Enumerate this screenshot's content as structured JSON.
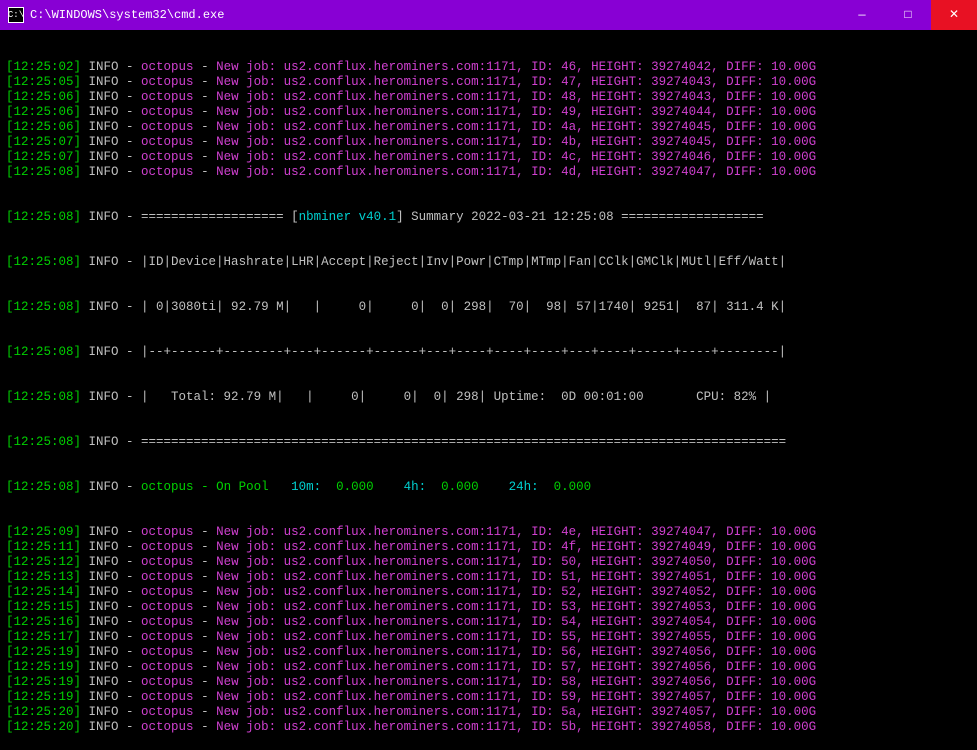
{
  "window": {
    "icon_symbol": "C:\\",
    "title": "C:\\WINDOWS\\system32\\cmd.exe",
    "minimize": "—",
    "maximize": "□",
    "close": "✕"
  },
  "lines": [
    {
      "ts": "[12:25:02]",
      "lvl": "INFO - ",
      "algo": "octopus",
      "sep": " - ",
      "rest": "New job: us2.conflux.herominers.com:1171, ID: 46, HEIGHT: 39274042, DIFF: 10.00G"
    },
    {
      "ts": "[12:25:05]",
      "lvl": "INFO - ",
      "algo": "octopus",
      "sep": " - ",
      "rest": "New job: us2.conflux.herominers.com:1171, ID: 47, HEIGHT: 39274043, DIFF: 10.00G"
    },
    {
      "ts": "[12:25:06]",
      "lvl": "INFO - ",
      "algo": "octopus",
      "sep": " - ",
      "rest": "New job: us2.conflux.herominers.com:1171, ID: 48, HEIGHT: 39274043, DIFF: 10.00G"
    },
    {
      "ts": "[12:25:06]",
      "lvl": "INFO - ",
      "algo": "octopus",
      "sep": " - ",
      "rest": "New job: us2.conflux.herominers.com:1171, ID: 49, HEIGHT: 39274044, DIFF: 10.00G"
    },
    {
      "ts": "[12:25:06]",
      "lvl": "INFO - ",
      "algo": "octopus",
      "sep": " - ",
      "rest": "New job: us2.conflux.herominers.com:1171, ID: 4a, HEIGHT: 39274045, DIFF: 10.00G"
    },
    {
      "ts": "[12:25:07]",
      "lvl": "INFO - ",
      "algo": "octopus",
      "sep": " - ",
      "rest": "New job: us2.conflux.herominers.com:1171, ID: 4b, HEIGHT: 39274045, DIFF: 10.00G"
    },
    {
      "ts": "[12:25:07]",
      "lvl": "INFO - ",
      "algo": "octopus",
      "sep": " - ",
      "rest": "New job: us2.conflux.herominers.com:1171, ID: 4c, HEIGHT: 39274046, DIFF: 10.00G"
    },
    {
      "ts": "[12:25:08]",
      "lvl": "INFO - ",
      "algo": "octopus",
      "sep": " - ",
      "rest": "New job: us2.conflux.herominers.com:1171, ID: 4d, HEIGHT: 39274047, DIFF: 10.00G"
    }
  ],
  "summary": {
    "row1": {
      "ts": "[12:25:08]",
      "lvl": "INFO - ",
      "txt": "=================== [",
      "prog": "nbminer v40.1",
      "mid": "] Summary 2022-03-21 12:25:08 ==================="
    },
    "row2": {
      "ts": "[12:25:08]",
      "lvl": "INFO - ",
      "txt": "|ID|Device|Hashrate|LHR|Accept|Reject|Inv|Powr|CTmp|MTmp|Fan|CClk|GMClk|MUtl|Eff/Watt|"
    },
    "row3": {
      "ts": "[12:25:08]",
      "lvl": "INFO - ",
      "txt": "| 0|3080ti| 92.79 M|   |     0|     0|  0| 298|  70|  98| 57|1740| 9251|  87| 311.4 K|"
    },
    "row4": {
      "ts": "[12:25:08]",
      "lvl": "INFO - ",
      "txt": "|--+------+--------+---+------+------+---+----+----+----+---+----+-----+----+--------|"
    },
    "row5": {
      "ts": "[12:25:08]",
      "lvl": "INFO - ",
      "txt": "|   Total: 92.79 M|   |     0|     0|  0| 298| Uptime:  0D 00:01:00       CPU: 82% |"
    },
    "row6": {
      "ts": "[12:25:08]",
      "lvl": "INFO - ",
      "txt": "======================================================================================"
    }
  },
  "poolrow": {
    "ts": "[12:25:08]",
    "lvl": "INFO - ",
    "algo": "octopus",
    "sep": " - On Pool   ",
    "p1": "10m:  ",
    "v1": "0.000",
    "p2": "    4h:  ",
    "v2": "0.000",
    "p3": "    24h:  ",
    "v3": "0.000"
  },
  "lines2": [
    {
      "ts": "[12:25:09]",
      "lvl": "INFO - ",
      "algo": "octopus",
      "sep": " - ",
      "rest": "New job: us2.conflux.herominers.com:1171, ID: 4e, HEIGHT: 39274047, DIFF: 10.00G"
    },
    {
      "ts": "[12:25:11]",
      "lvl": "INFO - ",
      "algo": "octopus",
      "sep": " - ",
      "rest": "New job: us2.conflux.herominers.com:1171, ID: 4f, HEIGHT: 39274049, DIFF: 10.00G"
    },
    {
      "ts": "[12:25:12]",
      "lvl": "INFO - ",
      "algo": "octopus",
      "sep": " - ",
      "rest": "New job: us2.conflux.herominers.com:1171, ID: 50, HEIGHT: 39274050, DIFF: 10.00G"
    },
    {
      "ts": "[12:25:13]",
      "lvl": "INFO - ",
      "algo": "octopus",
      "sep": " - ",
      "rest": "New job: us2.conflux.herominers.com:1171, ID: 51, HEIGHT: 39274051, DIFF: 10.00G"
    },
    {
      "ts": "[12:25:14]",
      "lvl": "INFO - ",
      "algo": "octopus",
      "sep": " - ",
      "rest": "New job: us2.conflux.herominers.com:1171, ID: 52, HEIGHT: 39274052, DIFF: 10.00G"
    },
    {
      "ts": "[12:25:15]",
      "lvl": "INFO - ",
      "algo": "octopus",
      "sep": " - ",
      "rest": "New job: us2.conflux.herominers.com:1171, ID: 53, HEIGHT: 39274053, DIFF: 10.00G"
    },
    {
      "ts": "[12:25:16]",
      "lvl": "INFO - ",
      "algo": "octopus",
      "sep": " - ",
      "rest": "New job: us2.conflux.herominers.com:1171, ID: 54, HEIGHT: 39274054, DIFF: 10.00G"
    },
    {
      "ts": "[12:25:17]",
      "lvl": "INFO - ",
      "algo": "octopus",
      "sep": " - ",
      "rest": "New job: us2.conflux.herominers.com:1171, ID: 55, HEIGHT: 39274055, DIFF: 10.00G"
    },
    {
      "ts": "[12:25:19]",
      "lvl": "INFO - ",
      "algo": "octopus",
      "sep": " - ",
      "rest": "New job: us2.conflux.herominers.com:1171, ID: 56, HEIGHT: 39274056, DIFF: 10.00G"
    },
    {
      "ts": "[12:25:19]",
      "lvl": "INFO - ",
      "algo": "octopus",
      "sep": " - ",
      "rest": "New job: us2.conflux.herominers.com:1171, ID: 57, HEIGHT: 39274056, DIFF: 10.00G"
    },
    {
      "ts": "[12:25:19]",
      "lvl": "INFO - ",
      "algo": "octopus",
      "sep": " - ",
      "rest": "New job: us2.conflux.herominers.com:1171, ID: 58, HEIGHT: 39274056, DIFF: 10.00G"
    },
    {
      "ts": "[12:25:19]",
      "lvl": "INFO - ",
      "algo": "octopus",
      "sep": " - ",
      "rest": "New job: us2.conflux.herominers.com:1171, ID: 59, HEIGHT: 39274057, DIFF: 10.00G"
    },
    {
      "ts": "[12:25:20]",
      "lvl": "INFO - ",
      "algo": "octopus",
      "sep": " - ",
      "rest": "New job: us2.conflux.herominers.com:1171, ID: 5a, HEIGHT: 39274057, DIFF: 10.00G"
    },
    {
      "ts": "[12:25:20]",
      "lvl": "INFO - ",
      "algo": "octopus",
      "sep": " - ",
      "rest": "New job: us2.conflux.herominers.com:1171, ID: 5b, HEIGHT: 39274058, DIFF: 10.00G"
    }
  ]
}
